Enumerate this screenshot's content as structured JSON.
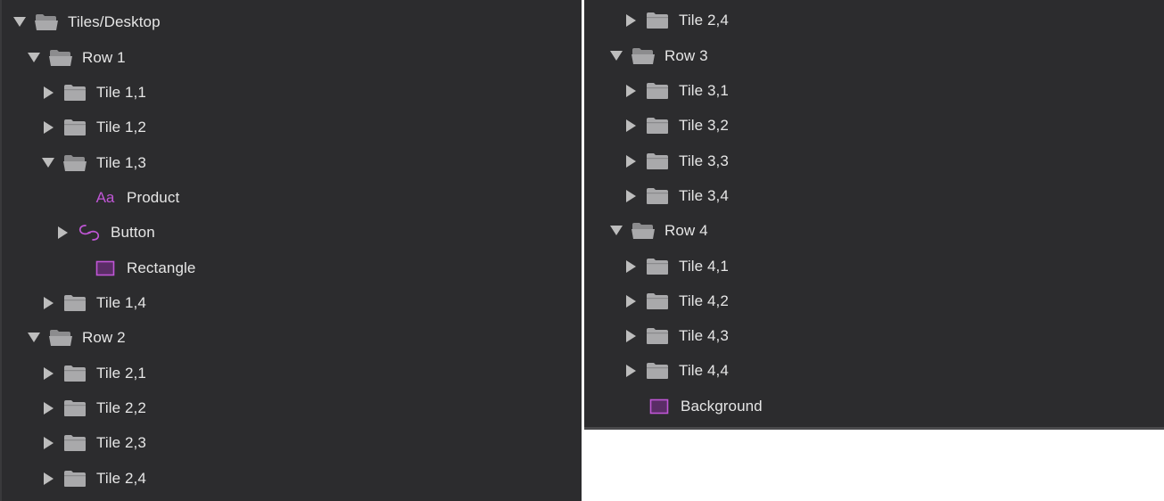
{
  "colors": {
    "panel_bg": "#2c2c2e",
    "text": "#e6e6e6",
    "folder": "#a9a9ab",
    "accent_purple": "#c056d6"
  },
  "left_panel": {
    "items": [
      {
        "label": "Tiles/Desktop",
        "icon": "folder-open-icon",
        "state": "expanded"
      },
      {
        "label": "Row 1",
        "icon": "folder-open-icon",
        "state": "expanded"
      },
      {
        "label": "Tile 1,1",
        "icon": "folder-icon",
        "state": "collapsed"
      },
      {
        "label": "Tile 1,2",
        "icon": "folder-icon",
        "state": "collapsed"
      },
      {
        "label": "Tile 1,3",
        "icon": "folder-open-icon",
        "state": "expanded"
      },
      {
        "label": "Product",
        "icon": "text-layer-icon",
        "state": "leaf"
      },
      {
        "label": "Button",
        "icon": "symbol-instance-icon",
        "state": "collapsed"
      },
      {
        "label": "Rectangle",
        "icon": "rectangle-icon",
        "state": "leaf"
      },
      {
        "label": "Tile 1,4",
        "icon": "folder-icon",
        "state": "collapsed"
      },
      {
        "label": "Row 2",
        "icon": "folder-open-icon",
        "state": "expanded"
      },
      {
        "label": "Tile 2,1",
        "icon": "folder-icon",
        "state": "collapsed"
      },
      {
        "label": "Tile 2,2",
        "icon": "folder-icon",
        "state": "collapsed"
      },
      {
        "label": "Tile 2,3",
        "icon": "folder-icon",
        "state": "collapsed"
      },
      {
        "label": "Tile 2,4",
        "icon": "folder-icon",
        "state": "collapsed"
      }
    ]
  },
  "right_panel": {
    "items": [
      {
        "label": "Tile 2,4",
        "icon": "folder-icon",
        "state": "collapsed"
      },
      {
        "label": "Row 3",
        "icon": "folder-open-icon",
        "state": "expanded"
      },
      {
        "label": "Tile 3,1",
        "icon": "folder-icon",
        "state": "collapsed"
      },
      {
        "label": "Tile 3,2",
        "icon": "folder-icon",
        "state": "collapsed"
      },
      {
        "label": "Tile 3,3",
        "icon": "folder-icon",
        "state": "collapsed"
      },
      {
        "label": "Tile 3,4",
        "icon": "folder-icon",
        "state": "collapsed"
      },
      {
        "label": "Row 4",
        "icon": "folder-open-icon",
        "state": "expanded"
      },
      {
        "label": "Tile 4,1",
        "icon": "folder-icon",
        "state": "collapsed"
      },
      {
        "label": "Tile 4,2",
        "icon": "folder-icon",
        "state": "collapsed"
      },
      {
        "label": "Tile 4,3",
        "icon": "folder-icon",
        "state": "collapsed"
      },
      {
        "label": "Tile 4,4",
        "icon": "folder-icon",
        "state": "collapsed"
      },
      {
        "label": "Background",
        "icon": "rectangle-icon",
        "state": "leaf"
      }
    ]
  },
  "text_icon_glyph": "Aa"
}
